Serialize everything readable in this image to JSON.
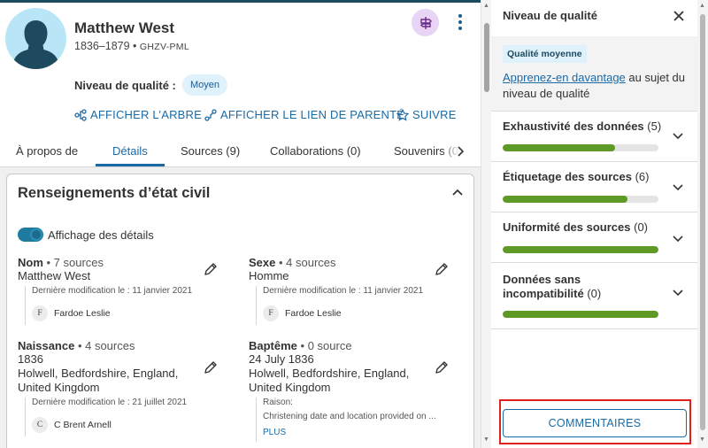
{
  "person": {
    "name": "Matthew West",
    "lifespan": "1836–1879",
    "separator": " • ",
    "pid": "GHZV-PML",
    "quality_label": "Niveau de qualité :",
    "quality_value": "Moyen"
  },
  "actions": [
    {
      "label": "AFFICHER L’ARBRE",
      "icon": "tree-icon"
    },
    {
      "label": "AFFICHER LE LIEN DE PARENTÉ",
      "icon": "relationship-icon"
    },
    {
      "label": "SUIVRE",
      "icon": "star-icon"
    }
  ],
  "tabs": [
    {
      "label": "À propos de"
    },
    {
      "label": "Détails",
      "active": true
    },
    {
      "label": "Sources (9)"
    },
    {
      "label": "Collaborations (0)"
    },
    {
      "label": "Souvenirs (0"
    }
  ],
  "card": {
    "title": "Renseignements d’état civil",
    "toggle_label": "Affichage des détails",
    "facts": [
      {
        "label": "Nom",
        "sources": " • 7 sources",
        "lines": [
          "Matthew West"
        ],
        "modified": "Dernière modification le : 11 janvier 2021",
        "initial": "F",
        "contributor": "Fardoe Leslie"
      },
      {
        "label": "Sexe",
        "sources": " • 4 sources",
        "lines": [
          "Homme"
        ],
        "modified": "Dernière modification le : 11 janvier 2021",
        "initial": "F",
        "contributor": "Fardoe Leslie"
      },
      {
        "label": "Naissance",
        "sources": " • 4 sources",
        "lines": [
          "1836",
          "Holwell, Bedfordshire, England,",
          "United Kingdom"
        ],
        "modified": "Dernière modification le : 21 juillet 2021",
        "initial": "C",
        "contributor": "C Brent Arnell"
      },
      {
        "label": "Baptême",
        "sources": " • 0 source",
        "lines": [
          "24 July 1836",
          "Holwell, Bedfordshire, England,",
          "United Kingdom"
        ],
        "reason_label": "Raison:",
        "reason": "Christening date and location provided on ...",
        "more": "PLUS"
      }
    ]
  },
  "panel": {
    "title": "Niveau de qualité",
    "badge": "Qualité moyenne",
    "learn_link": "Apprenez-en davantage",
    "learn_rest": " au sujet du niveau de qualité",
    "criteria": [
      {
        "title": "Exhaustivité des données",
        "count": " (5)",
        "progress": 0.72
      },
      {
        "title": "Étiquetage des sources",
        "count": " (6)",
        "progress": 0.8
      },
      {
        "title": "Uniformité des sources",
        "count": " (0)",
        "progress": 1.0
      },
      {
        "title": "Données sans incompatibilité",
        "count": " (0)",
        "progress": 1.0
      }
    ],
    "feedback_button": "COMMENTAIRES"
  },
  "colors": {
    "accent": "#1a6aa6",
    "progress": "#5f9a27",
    "highlight": "#e0201b"
  }
}
